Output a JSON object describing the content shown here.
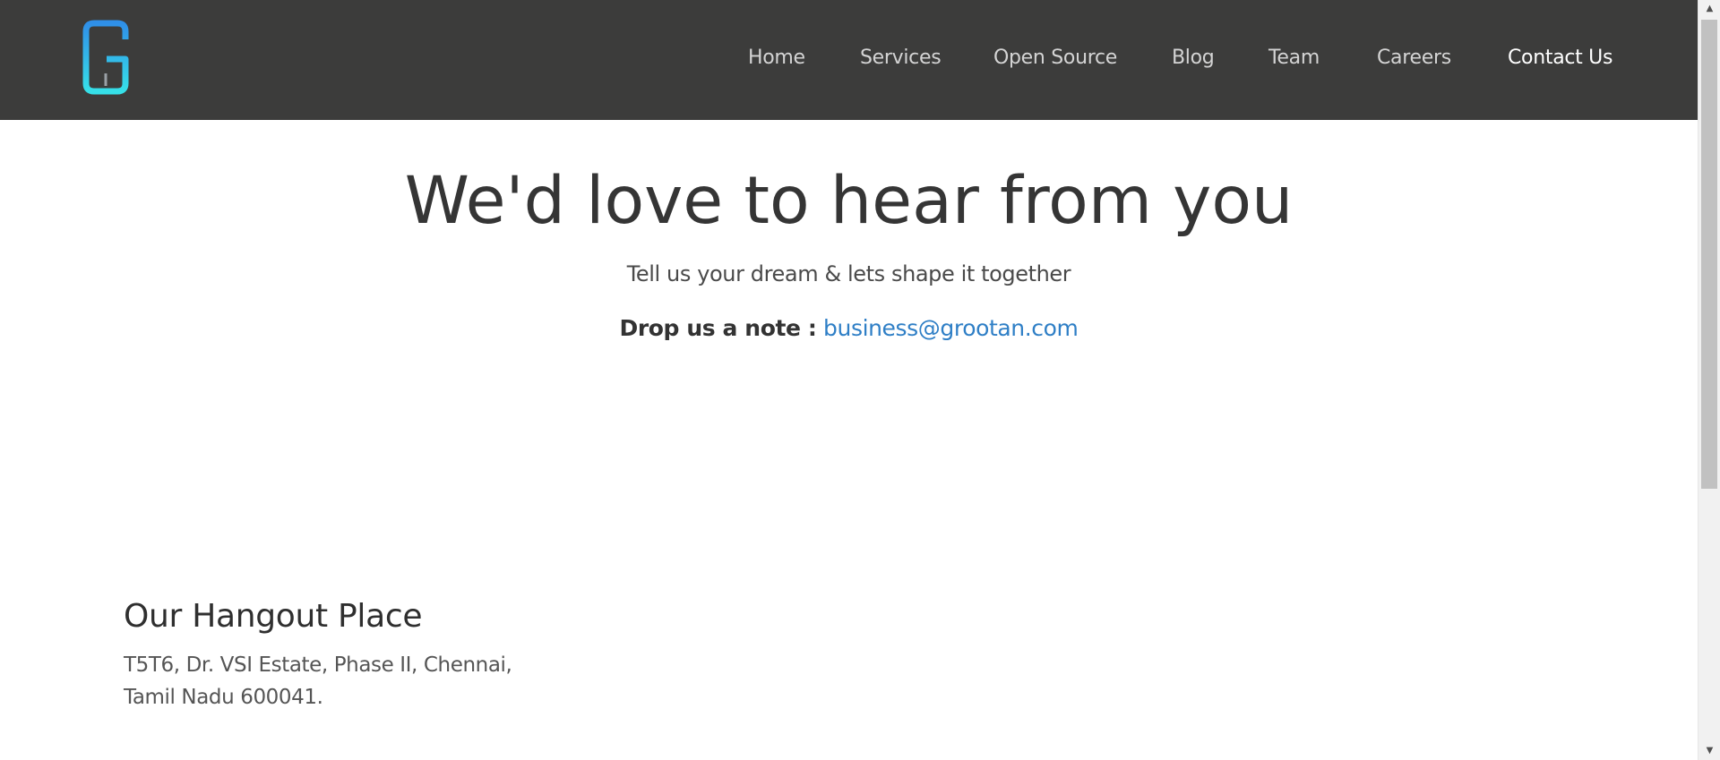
{
  "nav": {
    "items": [
      {
        "label": "Home"
      },
      {
        "label": "Services"
      },
      {
        "label": "Open Source"
      },
      {
        "label": "Blog"
      },
      {
        "label": "Team"
      },
      {
        "label": "Careers"
      },
      {
        "label": "Contact Us",
        "active": true
      }
    ]
  },
  "hero": {
    "title": "We'd love to hear from you",
    "subtitle": "Tell us your dream & lets shape it together",
    "note_label": "Drop us a note :",
    "email": "business@grootan.com"
  },
  "hangout": {
    "title": "Our Hangout Place",
    "address_line1": "T5T6, Dr. VSI Estate, Phase II, Chennai,",
    "address_line2": "Tamil Nadu 600041."
  },
  "colors": {
    "header_bg": "#3c3c3b",
    "logo_gradient_top": "#2f8fe8",
    "logo_gradient_bottom": "#36e0e8",
    "link": "#2f7fc6"
  },
  "icons": {
    "logo": "grootan-g-logo",
    "scroll_up": "scroll-up-arrow",
    "scroll_down": "scroll-down-arrow"
  }
}
